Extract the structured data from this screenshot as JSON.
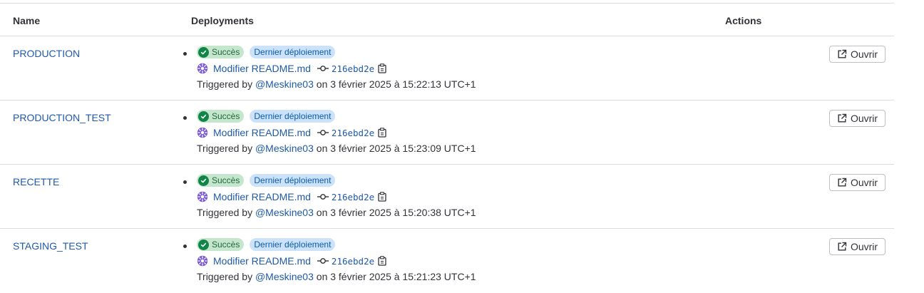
{
  "header": {
    "name": "Name",
    "deployments": "Deployments",
    "actions": "Actions"
  },
  "environments": [
    {
      "name": "PRODUCTION",
      "status": "Succès",
      "tag": "Dernier déploiement",
      "commit_title": "Modifier README.md",
      "sha": "216ebd2e",
      "triggered_prefix": "Triggered by",
      "user": "@Meskine03",
      "date": "on 3 février 2025 à 15:22:13 UTC+1",
      "action": "Ouvrir"
    },
    {
      "name": "PRODUCTION_TEST",
      "status": "Succès",
      "tag": "Dernier déploiement",
      "commit_title": "Modifier README.md",
      "sha": "216ebd2e",
      "triggered_prefix": "Triggered by",
      "user": "@Meskine03",
      "date": "on 3 février 2025 à 15:23:09 UTC+1",
      "action": "Ouvrir"
    },
    {
      "name": "RECETTE",
      "status": "Succès",
      "tag": "Dernier déploiement",
      "commit_title": "Modifier README.md",
      "sha": "216ebd2e",
      "triggered_prefix": "Triggered by",
      "user": "@Meskine03",
      "date": "on 3 février 2025 à 15:20:38 UTC+1",
      "action": "Ouvrir"
    },
    {
      "name": "STAGING_TEST",
      "status": "Succès",
      "tag": "Dernier déploiement",
      "commit_title": "Modifier README.md",
      "sha": "216ebd2e",
      "triggered_prefix": "Triggered by",
      "user": "@Meskine03",
      "date": "on 3 février 2025 à 15:21:23 UTC+1",
      "action": "Ouvrir"
    }
  ],
  "icons": {
    "status": "check-circle-icon",
    "avatar": "commit-author-avatar-icon",
    "commit": "commit-icon",
    "copy": "copy-to-clipboard-icon",
    "open": "external-link-icon"
  },
  "colors": {
    "link": "#1f5aa8",
    "success_bg": "#c3e6cd",
    "success_icon": "#108548",
    "tag_bg": "#cbe2f9",
    "avatar": "#7b58cf"
  }
}
